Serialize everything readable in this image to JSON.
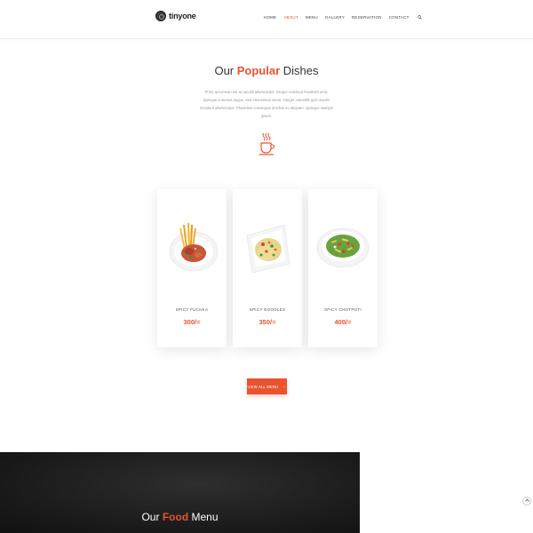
{
  "header": {
    "logo_text": "tinyone",
    "nav": [
      {
        "label": "HOME"
      },
      {
        "label": "ABOUT",
        "active": true
      },
      {
        "label": "MENU"
      },
      {
        "label": "GALLERY"
      },
      {
        "label": "RESERVATION"
      },
      {
        "label": "CONTACT"
      }
    ],
    "search_icon": "search-icon"
  },
  "popular": {
    "title_prefix": "Our",
    "title_accent": "Popular",
    "title_suffix": "Dishes",
    "intro": "Proin accumsan est ac iaculis ullamcorper. Integer euismod hendrerit urna. Quisque a semus augue, sed elementum lacus. Integer convallis quis mauris tincidunt ullamcorper. Phasellus consequat id tellus eu aliquam. Quisque suscipit ipsum.",
    "divider_icon": "coffee-cup-icon",
    "dishes": [
      {
        "name": "SPICY FUCHKA",
        "price": "300/="
      },
      {
        "name": "SPICY NOODLES",
        "price": "350/="
      },
      {
        "name": "SPICY CHOTPOTI",
        "price": "400/="
      }
    ],
    "view_button_label": "VIEW ALL MENU",
    "view_button_icon": "arrow-right-icon"
  },
  "food_menu": {
    "title_prefix": "Our",
    "title_accent": "Food",
    "title_suffix": "Menu"
  },
  "scroll_top_icon": "chevron-up-icon",
  "colors": {
    "accent": "#e8542f",
    "dark_bg": "#1c1c1c"
  }
}
